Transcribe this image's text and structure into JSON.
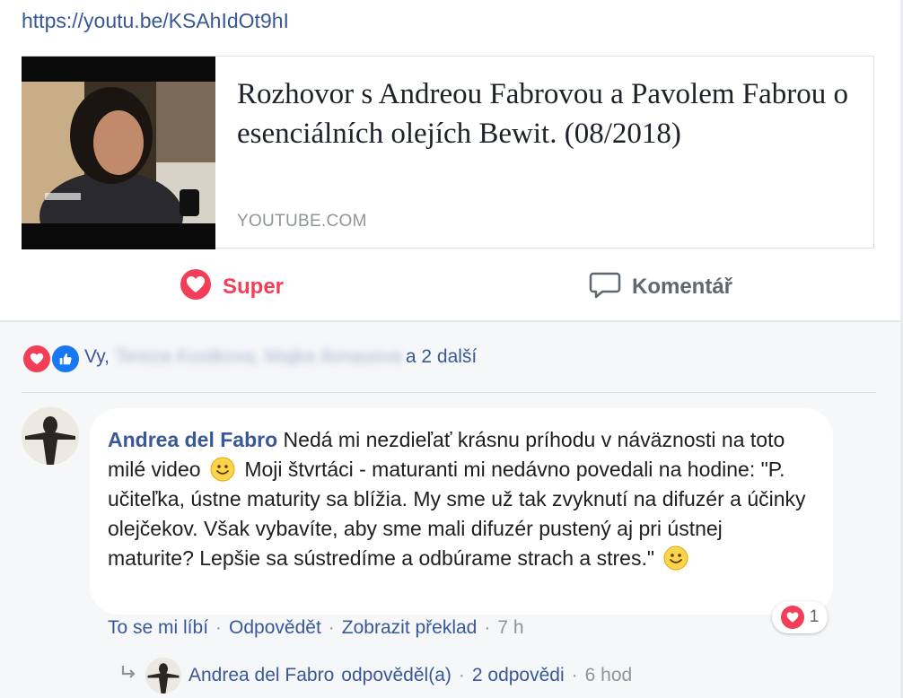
{
  "post": {
    "link_text": "https://youtu.be/KSAhIdOt9hI"
  },
  "preview": {
    "title": "Rozhovor s Andreou Fabrovou a Pavolem Fabrou o esenciálních olejích Bewit. (08/2018)",
    "domain": "YOUTUBE.COM"
  },
  "actions": {
    "super_label": "Super",
    "comment_label": "Komentář"
  },
  "reactions": {
    "you": "Vy,",
    "names_blurred": "Tereza Kostkova, Majka Ilonauova",
    "others": "a 2 další"
  },
  "comment": {
    "author": "Andrea del Fabro",
    "text_part1": "Nedá mi nezdieľať krásnu príhodu v náväznosti na toto milé video",
    "text_part2": "Moji štvrtáci - maturanti mi nedávno povedali na hodine: \"P. učiteľka, ústne maturity sa blížia. My sme už tak zvyknutí na difuzér a účinky olejčekov. Však vybavíte, aby sme mali difuzér pustený aj pri ústnej maturite? Lepšie sa sústredíme a odbúrame strach a stres.\"",
    "like_label": "To se mi líbí",
    "reply_label": "Odpovědět",
    "translate_label": "Zobrazit překlad",
    "separator": "·",
    "time": "7 h",
    "reaction_count": "1"
  },
  "replies": {
    "author": "Andrea del Fabro",
    "replied_text": "odpověděl(a)",
    "separator": "·",
    "count_label": "2 odpovědi",
    "time": "6 hod"
  },
  "colors": {
    "link": "#385898",
    "love": "#f33e58",
    "like": "#1877f2",
    "muted": "#90949c",
    "background_gray": "#f6f7f9"
  }
}
